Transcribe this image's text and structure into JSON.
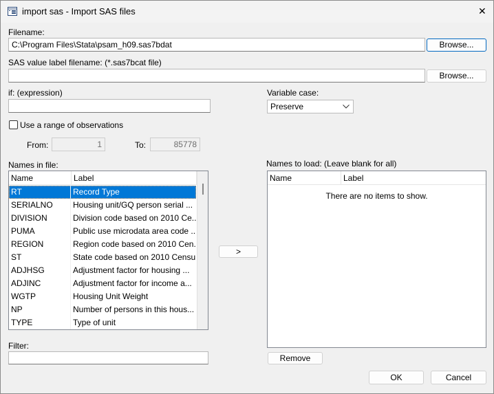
{
  "window": {
    "title": "import sas - Import SAS files",
    "close": "✕"
  },
  "filename": {
    "label": "Filename:",
    "value": "C:\\Program Files\\Stata\\psam_h09.sas7bdat",
    "browse": "Browse..."
  },
  "value_label": {
    "label": "SAS value label filename: (*.sas7bcat file)",
    "value": "",
    "browse": "Browse..."
  },
  "if_expr": {
    "label": "if: (expression)",
    "value": ""
  },
  "variable_case": {
    "label": "Variable case:",
    "selected": "Preserve"
  },
  "range": {
    "checkbox_label": "Use a range of observations",
    "checked": false,
    "from_label": "From:",
    "from_value": "1",
    "to_label": "To:",
    "to_value": "85778"
  },
  "names_in_file": {
    "label": "Names in file:",
    "columns": [
      "Name",
      "Label"
    ],
    "rows": [
      {
        "name": "RT",
        "label": "Record Type",
        "selected": true
      },
      {
        "name": "SERIALNO",
        "label": "Housing unit/GQ person serial ..."
      },
      {
        "name": "DIVISION",
        "label": "Division code based on 2010 Ce..."
      },
      {
        "name": "PUMA",
        "label": "Public use microdata area code ..."
      },
      {
        "name": "REGION",
        "label": "Region code based on 2010 Cen..."
      },
      {
        "name": "ST",
        "label": "State code based on 2010 Censu..."
      },
      {
        "name": "ADJHSG",
        "label": "Adjustment factor for housing ..."
      },
      {
        "name": "ADJINC",
        "label": "Adjustment factor for income a..."
      },
      {
        "name": "WGTP",
        "label": "Housing Unit Weight"
      },
      {
        "name": "NP",
        "label": "Number of persons in this hous..."
      },
      {
        "name": "TYPE",
        "label": "Type of unit"
      }
    ]
  },
  "move_button": ">",
  "names_to_load": {
    "label": "Names to load: (Leave blank for all)",
    "columns": [
      "Name",
      "Label"
    ],
    "empty": "There are no items to show."
  },
  "filter": {
    "label": "Filter:",
    "value": ""
  },
  "remove": "Remove",
  "ok": "OK",
  "cancel": "Cancel"
}
